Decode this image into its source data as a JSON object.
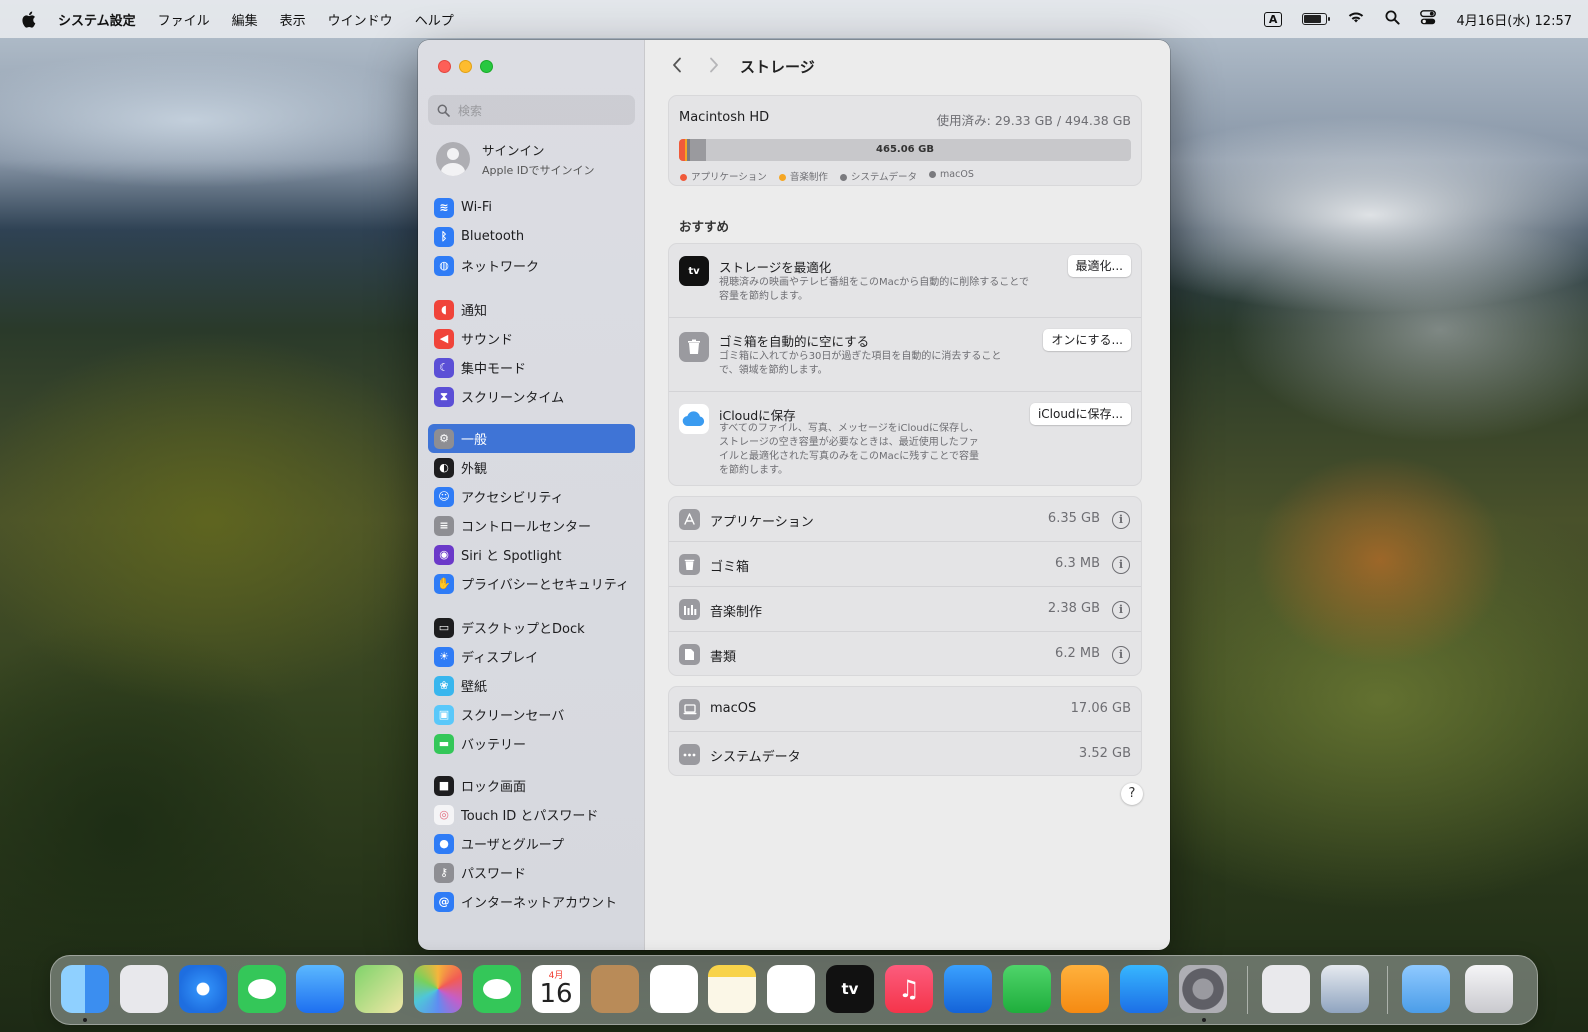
{
  "menubar": {
    "app_name": "システム設定",
    "items": [
      "ファイル",
      "編集",
      "表示",
      "ウインドウ",
      "ヘルプ"
    ],
    "input_mode": "A",
    "clock": "4月16日(水) 12:57"
  },
  "sidebar": {
    "search_placeholder": "検索",
    "signin_title": "サインイン",
    "signin_subtitle": "Apple IDでサインイン",
    "groups": [
      [
        {
          "label": "Wi-Fi",
          "icon": "wifi-icon",
          "color": "#2f7cf6"
        },
        {
          "label": "Bluetooth",
          "icon": "bluetooth-icon",
          "color": "#2f7cf6"
        },
        {
          "label": "ネットワーク",
          "icon": "globe-icon",
          "color": "#2f7cf6"
        }
      ],
      [
        {
          "label": "通知",
          "icon": "bell-icon",
          "color": "#f0443a"
        },
        {
          "label": "サウンド",
          "icon": "speaker-icon",
          "color": "#f0443a"
        },
        {
          "label": "集中モード",
          "icon": "moon-icon",
          "color": "#5b4fd6"
        },
        {
          "label": "スクリーンタイム",
          "icon": "hourglass-icon",
          "color": "#5b4fd6"
        }
      ],
      [
        {
          "label": "一般",
          "icon": "gear-icon",
          "color": "#8e8e93",
          "active": true
        },
        {
          "label": "外観",
          "icon": "appearance-icon",
          "color": "#1d1d1f"
        },
        {
          "label": "アクセシビリティ",
          "icon": "accessibility-icon",
          "color": "#2f7cf6"
        },
        {
          "label": "コントロールセンター",
          "icon": "control-center-icon",
          "color": "#8e8e93"
        },
        {
          "label": "Siri と Spotlight",
          "icon": "siri-icon",
          "color": "#6b39c9"
        },
        {
          "label": "プライバシーとセキュリティ",
          "icon": "hand-icon",
          "color": "#2f7cf6"
        }
      ],
      [
        {
          "label": "デスクトップとDock",
          "icon": "dock-icon",
          "color": "#1d1d1f"
        },
        {
          "label": "ディスプレイ",
          "icon": "sun-icon",
          "color": "#2f7cf6"
        },
        {
          "label": "壁紙",
          "icon": "wallpaper-icon",
          "color": "#38b6ee"
        },
        {
          "label": "スクリーンセーバ",
          "icon": "screensaver-icon",
          "color": "#5ac8fa"
        },
        {
          "label": "バッテリー",
          "icon": "battery-icon",
          "color": "#34c759"
        }
      ],
      [
        {
          "label": "ロック画面",
          "icon": "lock-icon",
          "color": "#1d1d1f"
        },
        {
          "label": "Touch ID とパスワード",
          "icon": "fingerprint-icon",
          "color": "#f4f4f6"
        },
        {
          "label": "ユーザとグループ",
          "icon": "users-icon",
          "color": "#2f7cf6"
        }
      ],
      [
        {
          "label": "パスワード",
          "icon": "key-icon",
          "color": "#8e8e93"
        },
        {
          "label": "インターネットアカウント",
          "icon": "at-icon",
          "color": "#2f7cf6"
        }
      ]
    ]
  },
  "content": {
    "title": "ストレージ",
    "disk": {
      "name": "Macintosh HD",
      "usage": "使用済み: 29.33 GB / 494.38 GB",
      "free_label": "465.06 GB",
      "segments": [
        {
          "name": "アプリケーション",
          "color": "#f05a3a",
          "gb": 6.35
        },
        {
          "name": "音楽制作",
          "color": "#f5a623",
          "gb": 2.38
        },
        {
          "name": "システムデータ",
          "color": "#7a7a7e",
          "gb": 3.52
        },
        {
          "name": "macOS",
          "color": "#9a9a9e",
          "gb": 17.06
        }
      ],
      "total_gb": 494.38
    },
    "section_label": "おすすめ",
    "recommendations": [
      {
        "title": "ストレージを最適化",
        "desc": [
          "視聴済みの映画やテレビ番組をこのMacから自動的に削除することで",
          "容量を節約します。"
        ],
        "button": "最適化...",
        "icon": "appletv-icon"
      },
      {
        "title": "ゴミ箱を自動的に空にする",
        "desc": [
          "ゴミ箱に入れてから30日が過ぎた項目を自動的に消去すること",
          "で、領域を節約します。"
        ],
        "button": "オンにする...",
        "icon": "trash-icon"
      },
      {
        "title": "iCloudに保存",
        "desc": [
          "すべてのファイル、写真、メッセージをiCloudに保存し、",
          "ストレージの空き容量が必要なときは、最近使用したファ",
          "イルと最適化された写真のみをこのMacに残すことで容量",
          "を節約します。"
        ],
        "button": "iCloudに保存...",
        "icon": "icloud-icon"
      }
    ],
    "categories": [
      {
        "label": "アプリケーション",
        "size": "6.35 GB",
        "icon": "appstore-icon"
      },
      {
        "label": "ゴミ箱",
        "size": "6.3 MB",
        "icon": "trash-icon"
      },
      {
        "label": "音楽制作",
        "size": "2.38 GB",
        "icon": "music-creation-icon"
      },
      {
        "label": "書類",
        "size": "6.2 MB",
        "icon": "document-icon"
      }
    ],
    "system": [
      {
        "label": "macOS",
        "size": "17.06 GB",
        "icon": "laptop-icon"
      },
      {
        "label": "システムデータ",
        "size": "3.52 GB",
        "icon": "ellipsis-icon"
      }
    ],
    "help": "?"
  },
  "dock": {
    "calendar_month": "4月",
    "calendar_day": "16",
    "apps": [
      "finder-icon",
      "launchpad-icon",
      "safari-icon",
      "messages-icon",
      "mail-icon",
      "maps-icon",
      "photos-icon",
      "facetime-icon",
      "calendar-icon",
      "contacts-icon",
      "reminders-icon",
      "notes-icon",
      "freeform-icon",
      "appletv-icon",
      "music-icon",
      "keynote-icon",
      "numbers-icon",
      "pages-icon",
      "appstore-icon",
      "system-settings-icon",
      "archive-utility-icon",
      "preview-icon",
      "downloads-folder-icon",
      "trash-icon"
    ]
  }
}
